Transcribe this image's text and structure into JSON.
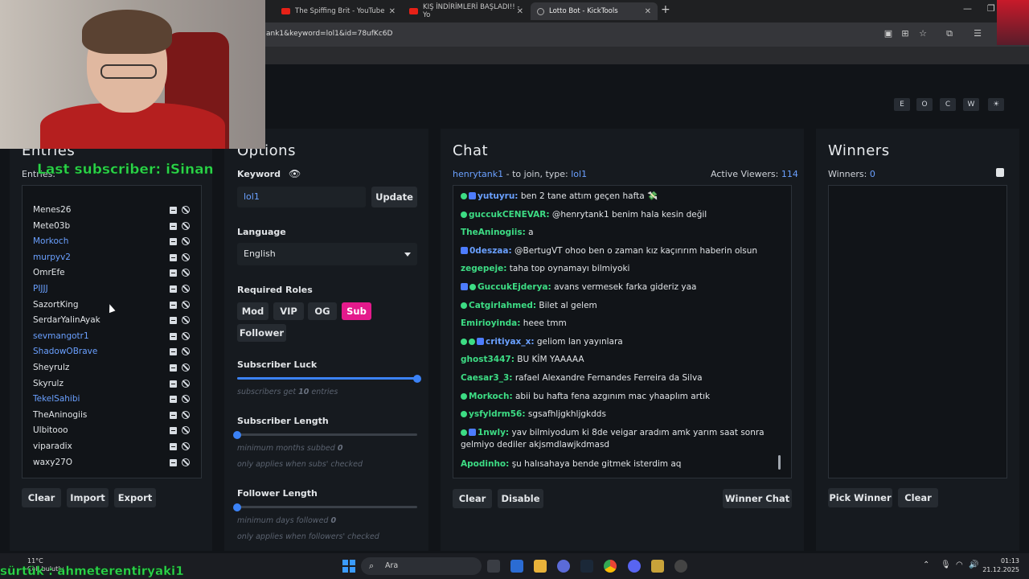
{
  "browser": {
    "tabs": [
      {
        "title": "The Spiffing Brit - YouTube"
      },
      {
        "title": "KIŞ İNDİRİMLERİ BAŞLADI!! - Yo"
      },
      {
        "title": "Lotto Bot - KickTools"
      }
    ],
    "url": "ank1&keyword=lol1&id=78ufKc6D"
  },
  "theme_buttons": [
    "E",
    "O",
    "C",
    "W",
    "☀"
  ],
  "entries": {
    "title": "Entries",
    "count_label": "Entries:",
    "items": [
      {
        "name": "Menes26",
        "sub": false
      },
      {
        "name": "Mete03b",
        "sub": false
      },
      {
        "name": "Morkoch",
        "sub": true
      },
      {
        "name": "murpyv2",
        "sub": true
      },
      {
        "name": "OmrEfe",
        "sub": false
      },
      {
        "name": "PIJJJ",
        "sub": true
      },
      {
        "name": "SazortKing",
        "sub": false
      },
      {
        "name": "SerdarYalinAyak",
        "sub": false
      },
      {
        "name": "sevmangotr1",
        "sub": true
      },
      {
        "name": "ShadowOBrave",
        "sub": true
      },
      {
        "name": "Sheyrulz",
        "sub": false
      },
      {
        "name": "Skyrulz",
        "sub": false
      },
      {
        "name": "TekelSahibi",
        "sub": true
      },
      {
        "name": "TheAninogiis",
        "sub": false
      },
      {
        "name": "Ulbitooo",
        "sub": false
      },
      {
        "name": "viparadix",
        "sub": false
      },
      {
        "name": "waxy27O",
        "sub": false
      }
    ],
    "buttons": {
      "clear": "Clear",
      "import": "Import",
      "export": "Export"
    }
  },
  "options": {
    "title": "Options",
    "keyword_label": "Keyword",
    "keyword_value": "lol1",
    "update_label": "Update",
    "language_label": "Language",
    "language_value": "English",
    "roles_label": "Required Roles",
    "roles": [
      {
        "label": "Mod",
        "active": false
      },
      {
        "label": "VIP",
        "active": false
      },
      {
        "label": "OG",
        "active": false
      },
      {
        "label": "Sub",
        "active": true
      },
      {
        "label": "Follower",
        "active": false
      }
    ],
    "sub_luck": {
      "label": "Subscriber Luck",
      "value": 10,
      "max": 10,
      "hint_pre": "subscribers get",
      "hint_post": "entries"
    },
    "sub_length": {
      "label": "Subscriber Length",
      "value": 0,
      "max": 12,
      "hint_pre": "minimum months subbed",
      "hint2": "only applies when subs' checked"
    },
    "follower_length": {
      "label": "Follower Length",
      "value": 0,
      "max": 365,
      "hint_pre": "minimum days followed",
      "hint2": "only applies when followers' checked"
    }
  },
  "chat": {
    "title": "Chat",
    "join_user": "henrytank1",
    "join_text": "- to join, type:",
    "join_keyword": "lol1",
    "viewers_label": "Active Viewers:",
    "viewers_value": "114",
    "messages": [
      {
        "user": "yutuyru:",
        "color": "bl",
        "badges": [
          "star",
          "sub"
        ],
        "text": "ben 2 tane attım geçen hafta 💸"
      },
      {
        "user": "guccukCENEVAR:",
        "color": "g",
        "badges": [
          "star"
        ],
        "text": "@henrytank1 benim hala kesin değil"
      },
      {
        "user": "TheAninogiis:",
        "color": "g",
        "badges": [],
        "text": "a"
      },
      {
        "user": "0deszaa:",
        "color": "bl",
        "badges": [
          "sub"
        ],
        "text": "@BertugVT ohoo ben o zaman kız kaçırırım haberin olsun"
      },
      {
        "user": "zegepeje:",
        "color": "g",
        "badges": [],
        "text": "taha top oynamayı bilmiyoki"
      },
      {
        "user": "GuccukEjderya:",
        "color": "g",
        "badges": [
          "sub",
          "star"
        ],
        "text": "avans vermesek farka gideriz yaa"
      },
      {
        "user": "Catgirlahmed:",
        "color": "g",
        "badges": [
          "star"
        ],
        "text": "Bilet al gelem"
      },
      {
        "user": "Emirioyinda:",
        "color": "g",
        "badges": [],
        "text": "heee tmm"
      },
      {
        "user": "critiyax_x:",
        "color": "bl",
        "badges": [
          "star",
          "star",
          "sub"
        ],
        "text": "geliom lan yayınlara"
      },
      {
        "user": "ghost3447:",
        "color": "g",
        "badges": [],
        "text": "BU KİM YAAAAA"
      },
      {
        "user": "Caesar3_3:",
        "color": "g",
        "badges": [],
        "text": "rafael Alexandre Fernandes Ferreira da Silva"
      },
      {
        "user": "Morkoch:",
        "color": "g",
        "badges": [
          "star"
        ],
        "text": "abii bu hafta fena azgınım mac yhaaplım artık"
      },
      {
        "user": "ysfyldrm56:",
        "color": "g",
        "badges": [
          "star"
        ],
        "text": "sgsafhljgkhljgkdds"
      },
      {
        "user": "1nwly:",
        "color": "g",
        "badges": [
          "star",
          "sub"
        ],
        "text": "yav bilmiyodum ki 8de veigar aradım amk yarım saat sonra gelmiyo dediler akjsmdlawjkdmasd"
      },
      {
        "user": "Apodinho:",
        "color": "g",
        "badges": [],
        "text": "şu halısahaya bende gitmek isterdim aq"
      }
    ],
    "buttons": {
      "clear": "Clear",
      "disable": "Disable",
      "winner_chat": "Winner Chat"
    }
  },
  "winners": {
    "title": "Winners",
    "count_label": "Winners:",
    "count_value": "0",
    "buttons": {
      "pick": "Pick Winner",
      "clear": "Clear"
    }
  },
  "stream_overlay": {
    "last_subscriber": "Last subscriber: iSinan",
    "follower_ticker": "sürtük : ahmeterentiryaki1"
  },
  "taskbar": {
    "search_placeholder": "Ara",
    "weather_temp": "11°C",
    "weather_desc": "Çok bulutlu",
    "time": "01:13",
    "date": "21.12.2025"
  }
}
